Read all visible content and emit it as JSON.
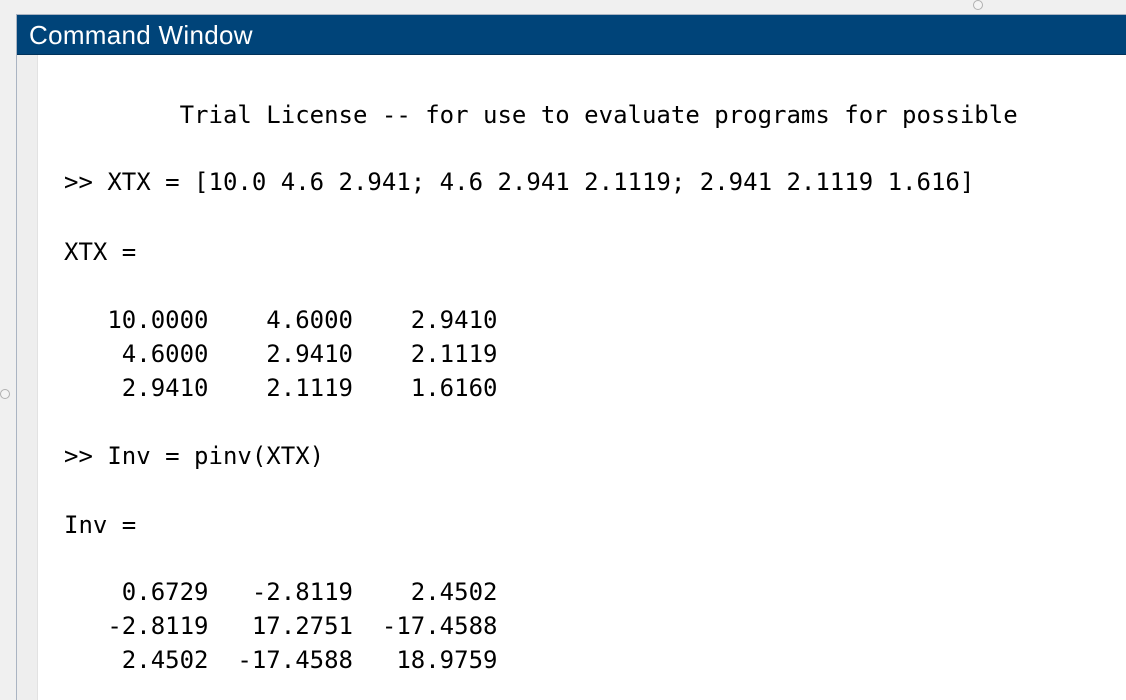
{
  "window": {
    "title": "Command Window"
  },
  "console": {
    "license_line": "        Trial License -- for use to evaluate programs for possible",
    "cmd1": ">> XTX = [10.0 4.6 2.941; 4.6 2.941 2.1119; 2.941 2.1119 1.616]",
    "out1_label": "XTX =",
    "out1_rows": [
      "   10.0000    4.6000    2.9410",
      "    4.6000    2.9410    2.1119",
      "    2.9410    2.1119    1.6160"
    ],
    "cmd2": ">> Inv = pinv(XTX)",
    "out2_label": "Inv =",
    "out2_rows": [
      "    0.6729   -2.8119    2.4502",
      "   -2.8119   17.2751  -17.4588",
      "    2.4502  -17.4588   18.9759"
    ]
  }
}
